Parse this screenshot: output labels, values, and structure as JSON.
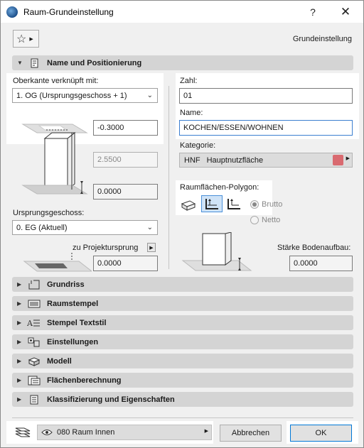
{
  "window": {
    "title": "Raum-Grundeinstellung",
    "help_label": "?",
    "close_label": "✕"
  },
  "header": {
    "favorites_icon": "star-icon",
    "settings_title": "Grundeinstellung"
  },
  "section_name_pos": {
    "label": "Name und Positionierung"
  },
  "left": {
    "top_link_label": "Oberkante verknüpft mit:",
    "top_link_value": "1. OG (Ursprungsgeschoss + 1)",
    "top_offset": "-0.3000",
    "height": "2.5500",
    "bottom_offset": "0.0000",
    "home_story_label": "Ursprungsgeschoss:",
    "home_story_value": "0. EG (Aktuell)",
    "ref_label": "zu Projektursprung",
    "ref_value": "0.0000"
  },
  "right": {
    "number_label": "Zahl:",
    "number_value": "01",
    "name_label": "Name:",
    "name_value": "KOCHEN/ESSEN/WOHNEN",
    "category_label": "Kategorie:",
    "category_code": "HNF",
    "category_name": "Hauptnutzfläche",
    "category_color": "#d96a70",
    "polygon_label": "Raumflächen-Polygon:",
    "radio_gross": "Brutto",
    "radio_net": "Netto",
    "floor_thickness_label": "Stärke Bodenaufbau:",
    "floor_thickness_value": "0.0000"
  },
  "sections": [
    {
      "label": "Grundriss",
      "icon": "floor-plan-icon"
    },
    {
      "label": "Raumstempel",
      "icon": "zone-stamp-icon"
    },
    {
      "label": "Stempel Textstil",
      "icon": "text-style-icon"
    },
    {
      "label": "Einstellungen",
      "icon": "settings-icon"
    },
    {
      "label": "Modell",
      "icon": "model-icon"
    },
    {
      "label": "Flächenberechnung",
      "icon": "area-calc-icon"
    },
    {
      "label": "Klassifizierung und Eigenschaften",
      "icon": "classification-icon"
    }
  ],
  "footer": {
    "layer_value": "080 Raum Innen",
    "cancel_label": "Abbrechen",
    "ok_label": "OK"
  }
}
